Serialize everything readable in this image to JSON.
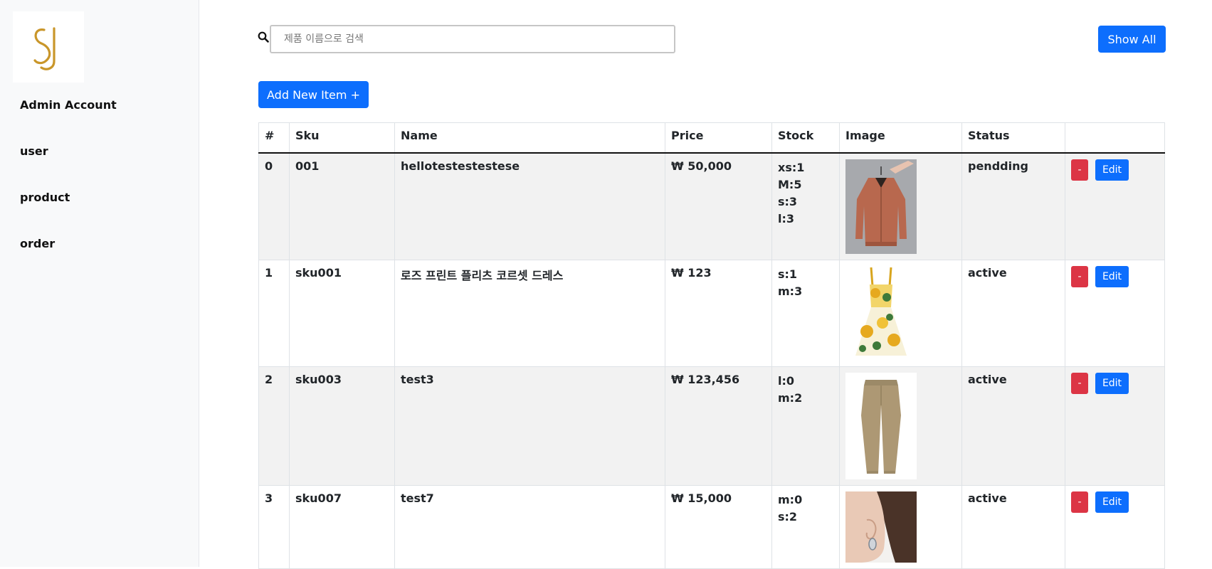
{
  "sidebar": {
    "logo_text": "SJ",
    "items": [
      {
        "label": "Admin Account"
      },
      {
        "label": "user"
      },
      {
        "label": "product"
      },
      {
        "label": "order"
      }
    ]
  },
  "search": {
    "placeholder": "제품 이름으로 검색",
    "value": ""
  },
  "buttons": {
    "show_all": "Show All",
    "add_new": "Add New Item +",
    "delete": "-",
    "edit": "Edit"
  },
  "table": {
    "headers": [
      "#",
      "Sku",
      "Name",
      "Price",
      "Stock",
      "Image",
      "Status",
      ""
    ],
    "rows": [
      {
        "index": "0",
        "sku": "001",
        "name": "hellotestestestese",
        "price": "₩ 50,000",
        "stock": [
          "xs:1",
          "M:5",
          "s:3",
          "l:3"
        ],
        "image": "brown-bomber-jacket",
        "status": "pendding"
      },
      {
        "index": "1",
        "sku": "sku001",
        "name": "로즈 프린트 플리츠 코르셋 드레스",
        "price": "₩ 123",
        "stock": [
          "s:1",
          "m:3"
        ],
        "image": "yellow-rose-print-dress",
        "status": "active"
      },
      {
        "index": "2",
        "sku": "sku003",
        "name": "test3",
        "price": "₩ 123,456",
        "stock": [
          "l:0",
          "m:2"
        ],
        "image": "khaki-pants",
        "status": "active"
      },
      {
        "index": "3",
        "sku": "sku007",
        "name": "test7",
        "price": "₩ 15,000",
        "stock": [
          "m:0",
          "s:2"
        ],
        "image": "silver-earring",
        "status": "active"
      }
    ]
  },
  "colors": {
    "primary": "#0d6efd",
    "danger": "#dc3545",
    "logo_gold": "#c9962a",
    "sidebar_bg": "#f8f9fa",
    "stripe": "#f2f2f2"
  }
}
